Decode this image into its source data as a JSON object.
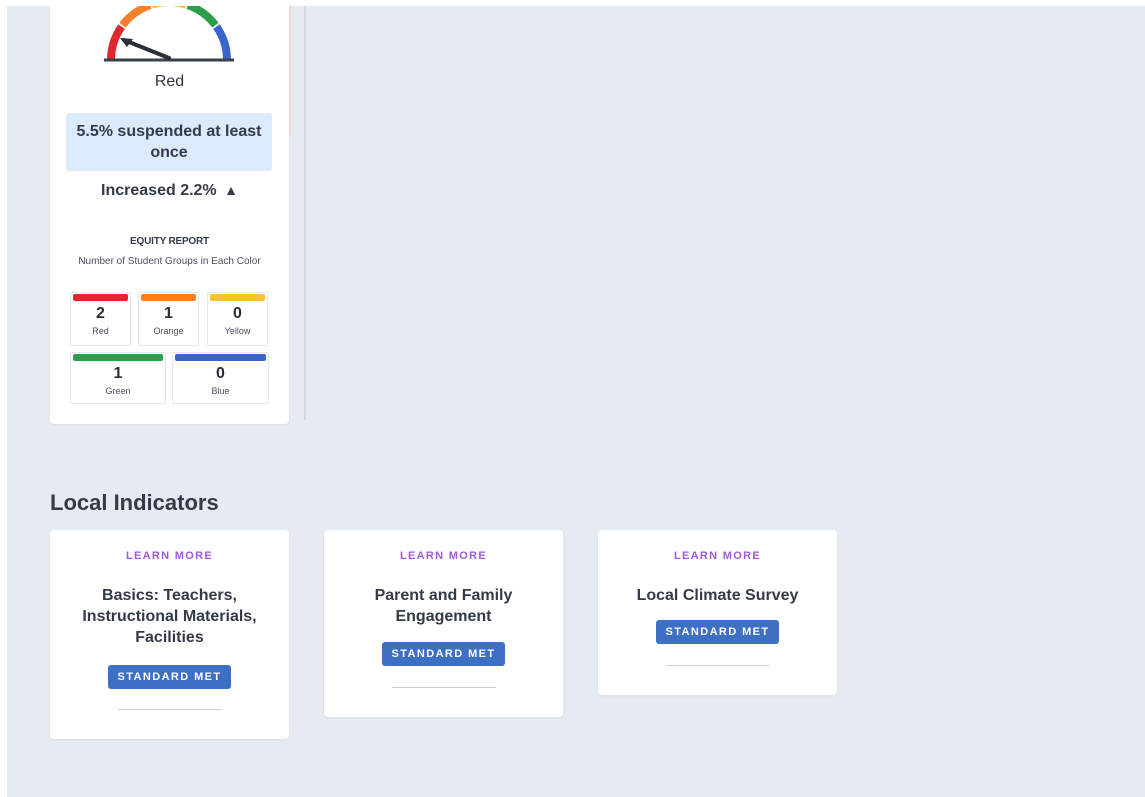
{
  "indicator": {
    "status": "Red",
    "summary": "5.5% suspended at least once",
    "change_text": "Increased 2.2%",
    "change_arrow": "▲",
    "gauge_colors": [
      "#e0262f",
      "#f4802b",
      "#f7c234",
      "#2f9e4c",
      "#3b64cc"
    ],
    "equity": {
      "title": "EQUITY REPORT",
      "subtitle": "Number of Student Groups in Each Color",
      "groups": [
        {
          "label": "Red",
          "count": "2",
          "color": "#e0262f"
        },
        {
          "label": "Orange",
          "count": "1",
          "color": "#f4802b"
        },
        {
          "label": "Yellow",
          "count": "0",
          "color": "#f7c234"
        },
        {
          "label": "Green",
          "count": "1",
          "color": "#2f9e4c"
        },
        {
          "label": "Blue",
          "count": "0",
          "color": "#3b64cc"
        }
      ]
    }
  },
  "local": {
    "title": "Local Indicators",
    "cards": [
      {
        "learn_more": "LEARN MORE",
        "title": "Basics: Teachers, Instructional Materials, Facilities",
        "badge": "STANDARD MET"
      },
      {
        "learn_more": "LEARN MORE",
        "title": "Parent and Family Engagement",
        "badge": "STANDARD MET"
      },
      {
        "learn_more": "LEARN MORE",
        "title": "Local Climate Survey",
        "badge": "STANDARD MET"
      }
    ]
  },
  "colors": {
    "accent_purple": "#a15ad2",
    "badge_blue": "#3d6fc4",
    "canvas_bg": "#e6ebf2",
    "summary_bg": "#dcebfb"
  }
}
